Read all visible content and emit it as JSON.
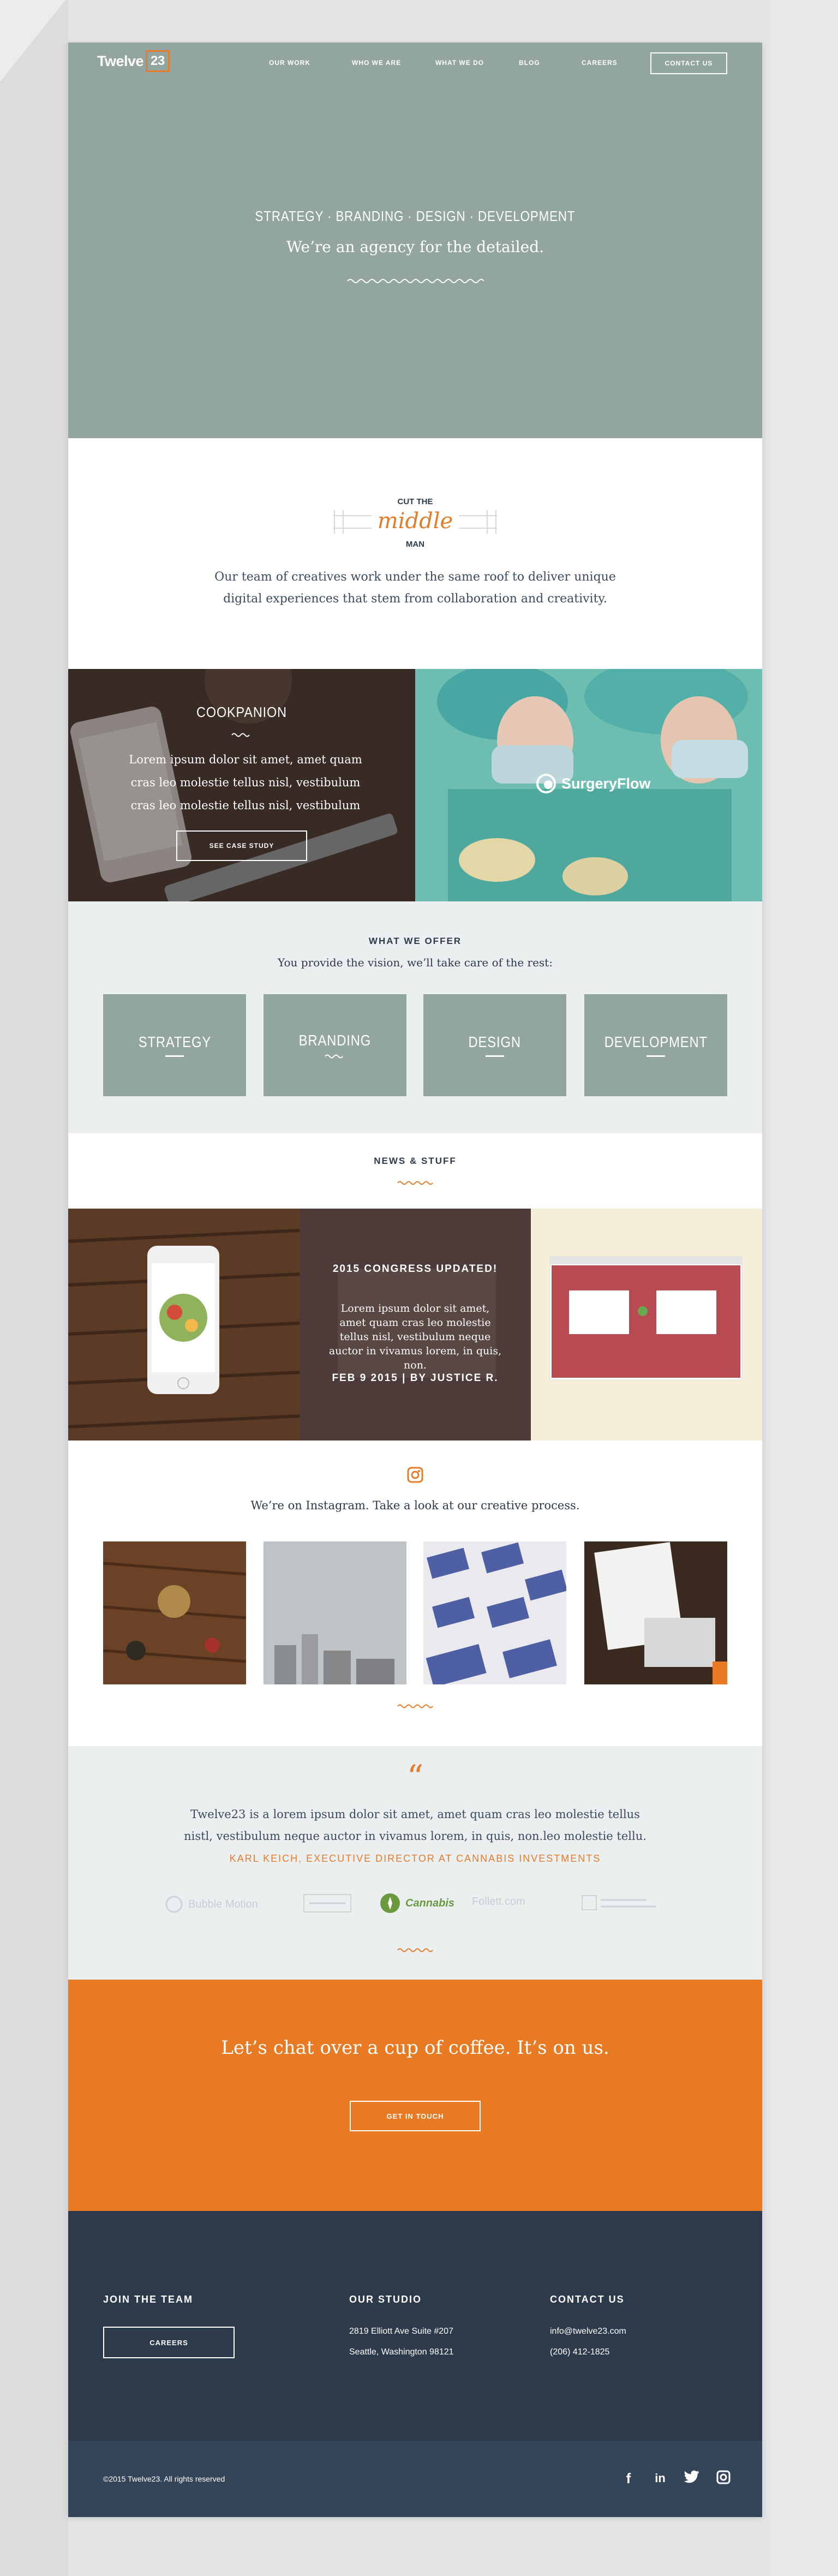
{
  "brand": {
    "name": "Twelve",
    "num": "23",
    "accent": "#e47c2a"
  },
  "nav": {
    "items": [
      "OUR WORK",
      "WHO WE ARE",
      "WHAT WE DO",
      "BLOG",
      "CAREERS"
    ],
    "contact": "CONTACT US"
  },
  "hero": {
    "kicker": "STRATEGY · BRANDING · DESIGN · DEVELOPMENT",
    "sub": "We’re an agency for the detailed."
  },
  "middleman": {
    "badge_top": "CUT THE",
    "badge_script": "middle",
    "badge_bottom": "MAN",
    "text": "Our team of creatives work under the same roof to deliver unique digital experiences that stem from collaboration and creativity."
  },
  "case_study": {
    "title": "COOKPANION",
    "text": "Lorem ipsum dolor sit amet, amet quam cras leo molestie tellus nisl, vestibulum cras leo molestie tellus nisl, vestibulum",
    "button": "SEE CASE STUDY",
    "right_logo": "SurgeryFlow"
  },
  "offer": {
    "title": "WHAT WE OFFER",
    "sub": "You provide the vision, we’ll take care of the rest:",
    "items": [
      "STRATEGY",
      "BRANDING",
      "DESIGN",
      "DEVELOPMENT"
    ]
  },
  "news": {
    "title": "NEWS & STUFF",
    "post_title": "2015 CONGRESS UPDATED!",
    "post_text": "Lorem ipsum dolor sit amet, amet quam cras leo molestie tellus nisl, vestibulum neque auctor in vivamus lorem, in quis, non.",
    "post_date": "FEB 9 2015 | BY JUSTICE R."
  },
  "instagram": {
    "text": "We’re on Instagram. Take a look at our creative process."
  },
  "testimonial": {
    "quote_mark": "“",
    "text": "Twelve23 is a lorem ipsum dolor sit amet, amet quam cras leo molestie tellus nistl, vestibulum neque auctor in vivamus lorem, in quis, non.leo molestie tellu.",
    "author": "KARL KEICH, EXECUTIVE DIRECTOR AT CANNABIS INVESTMENTS",
    "logos": [
      "Bubble Motion",
      "Cannabis",
      "Follett.com"
    ]
  },
  "cta": {
    "title": "Let’s chat over a cup of coffee. It’s on us.",
    "button": "GET IN TOUCH"
  },
  "footer": {
    "join_title": "JOIN THE TEAM",
    "join_button": "CAREERS",
    "studio_title": "OUR STUDIO",
    "address1": "2819 Elliott Ave Suite #207",
    "address2": "Seattle, Washington 98121",
    "contact_title": "CONTACT US",
    "email": "info@twelve23.com",
    "phone": "(206) 412-1825",
    "copyright": "©2015 Twelve23. All rights reserved",
    "social": [
      "f",
      "in",
      "twitter",
      "instagram"
    ]
  }
}
